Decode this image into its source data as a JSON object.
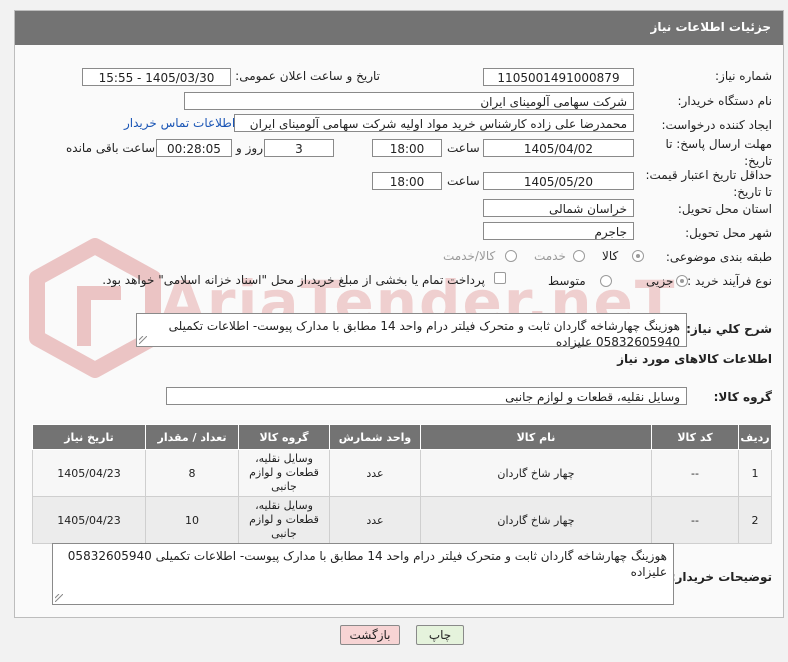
{
  "header": {
    "title": "جزئیات اطلاعات نیاز"
  },
  "fields": {
    "need_number_label": "شماره نیاز:",
    "need_number": "1105001491000879",
    "announce_label": "تاریخ و ساعت اعلان عمومی:",
    "announce_value": "1405/03/30 - 15:55",
    "buyer_org_label": "نام دستگاه خریدار:",
    "buyer_org": "شرکت سهامی آلومینای ایران",
    "creator_label": "ایجاد کننده درخواست:",
    "creator": "محمدرضا علی زاده کارشناس خرید مواد اولیه شرکت سهامی آلومینای ایران",
    "contact_link": "اطلاعات تماس خریدار",
    "reply_deadline_label_1": "مهلت ارسال پاسخ: تا",
    "reply_deadline_label_2": "تاریخ:",
    "reply_date": "1405/04/02",
    "hour_label": "ساعت",
    "reply_time": "18:00",
    "days": "3",
    "days_label": "روز و",
    "remaining": "00:28:05",
    "remaining_label": "ساعت باقی مانده",
    "validity_label_1": "حداقل تاریخ اعتبار قیمت:",
    "validity_label_2": "تا تاریخ:",
    "validity_date": "1405/05/20",
    "validity_time": "18:00",
    "province_label": "استان محل تحویل:",
    "province": "خراسان شمالی",
    "city_label": "شهر محل تحویل:",
    "city": "جاجرم",
    "category_label": "طبقه بندی موضوعی:",
    "cat_goods": "کالا",
    "cat_service": "خدمت",
    "cat_goods_service": "کالا/خدمت",
    "process_label": "نوع فرآیند خرید :",
    "proc_partial": "جزیی",
    "proc_medium": "متوسط",
    "payment_note": "پرداخت تمام یا بخشی از مبلغ خرید،از محل \"اسناد خزانه اسلامی\" خواهد بود."
  },
  "description": {
    "label": "شرح کلي نياز:",
    "text": "هوزینگ چهارشاخه گاردان ثابت و متحرک فیلتر درام واحد 14 مطابق با مدارک پیوست- اطلاعات تکمیلی 05832605940 علیزاده"
  },
  "goods_section": {
    "title": "اطلاعات کالاهای مورد نیاز",
    "group_label": "گروه کالا:",
    "group_value": "وسایل نقلیه، قطعات و لوازم جانبی"
  },
  "table": {
    "headers": [
      "ردیف",
      "کد کالا",
      "نام کالا",
      "واحد شمارش",
      "گروه کالا",
      "تعداد / مقدار",
      "تاریخ نیاز"
    ],
    "rows": [
      {
        "idx": "1",
        "code": "--",
        "name": "چهار شاخ گاردان",
        "unit": "عدد",
        "group": "وسایل نقلیه، قطعات و لوازم جانبی",
        "qty": "8",
        "date": "1405/04/23"
      },
      {
        "idx": "2",
        "code": "--",
        "name": "چهار شاخ گاردان",
        "unit": "عدد",
        "group": "وسایل نقلیه، قطعات و لوازم جانبی",
        "qty": "10",
        "date": "1405/04/23"
      }
    ]
  },
  "buyer_notes": {
    "label": "توضیحات خریدار:",
    "text": "هوزینگ چهارشاخه گاردان ثابت و متحرک فیلتر درام واحد 14 مطابق با مدارک پیوست- اطلاعات تکمیلی 05832605940 علیزاده"
  },
  "buttons": {
    "print": "چاپ",
    "back": "بازگشت"
  },
  "watermark": "AriaTender.neT",
  "colors": {
    "header_bg": "#737373",
    "link": "#1a55b5",
    "watermark": "#e2b0b0",
    "back_btn": "#f7d4d4",
    "print_btn": "#e5f3dc"
  }
}
